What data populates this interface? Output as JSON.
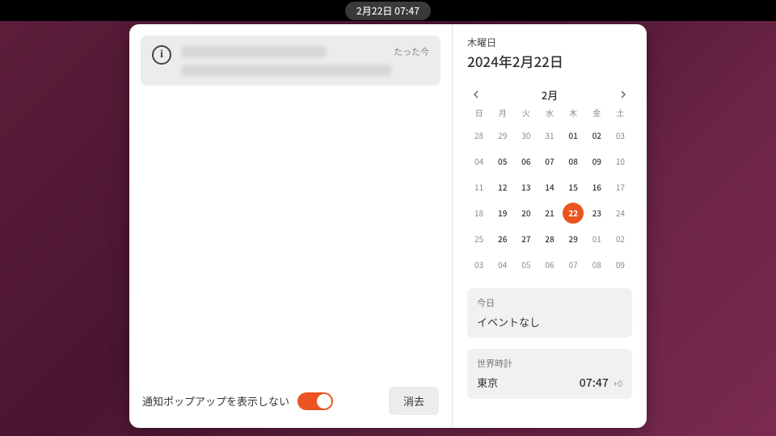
{
  "topbar": {
    "datetime": "2月22日  07:47"
  },
  "notifications": {
    "item": {
      "time": "たった今"
    },
    "dnd_label": "通知ポップアップを表示しない",
    "clear_label": "消去",
    "dnd_on": true
  },
  "date_header": {
    "weekday": "木曜日",
    "fulldate": "2024年2月22日"
  },
  "calendar": {
    "month_label": "2月",
    "dow": [
      "日",
      "月",
      "火",
      "水",
      "木",
      "金",
      "土"
    ],
    "weeks": [
      [
        {
          "d": "28"
        },
        {
          "d": "29"
        },
        {
          "d": "30"
        },
        {
          "d": "31"
        },
        {
          "d": "01",
          "cur": true
        },
        {
          "d": "02",
          "cur": true
        },
        {
          "d": "03"
        }
      ],
      [
        {
          "d": "04"
        },
        {
          "d": "05",
          "cur": true
        },
        {
          "d": "06",
          "cur": true
        },
        {
          "d": "07",
          "cur": true
        },
        {
          "d": "08",
          "cur": true
        },
        {
          "d": "09",
          "cur": true
        },
        {
          "d": "10"
        }
      ],
      [
        {
          "d": "11"
        },
        {
          "d": "12",
          "cur": true
        },
        {
          "d": "13",
          "cur": true
        },
        {
          "d": "14",
          "cur": true
        },
        {
          "d": "15",
          "cur": true
        },
        {
          "d": "16",
          "cur": true
        },
        {
          "d": "17"
        }
      ],
      [
        {
          "d": "18"
        },
        {
          "d": "19",
          "cur": true
        },
        {
          "d": "20",
          "cur": true
        },
        {
          "d": "21",
          "cur": true
        },
        {
          "d": "22",
          "cur": true,
          "today": true
        },
        {
          "d": "23",
          "cur": true
        },
        {
          "d": "24"
        }
      ],
      [
        {
          "d": "25"
        },
        {
          "d": "26",
          "cur": true
        },
        {
          "d": "27",
          "cur": true
        },
        {
          "d": "28",
          "cur": true
        },
        {
          "d": "29",
          "cur": true
        },
        {
          "d": "01"
        },
        {
          "d": "02"
        }
      ],
      [
        {
          "d": "03"
        },
        {
          "d": "04"
        },
        {
          "d": "05"
        },
        {
          "d": "06"
        },
        {
          "d": "07"
        },
        {
          "d": "08"
        },
        {
          "d": "09"
        }
      ]
    ]
  },
  "events": {
    "title": "今日",
    "body": "イベントなし"
  },
  "world_clock": {
    "title": "世界時計",
    "city": "東京",
    "time": "07:47",
    "offset": "+0"
  }
}
